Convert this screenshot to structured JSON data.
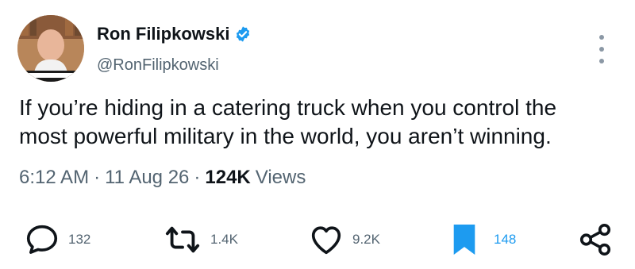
{
  "author": {
    "display_name": "Ron Filipkowski",
    "handle": "@RonFilipkowski",
    "verified": true,
    "avatar_icon": "profile-photo"
  },
  "tweet": {
    "text": "If you’re hiding in a catering truck when you control the\nmost powerful military in the world, you aren’t winning."
  },
  "meta": {
    "time": "6:12 AM",
    "separator": "·",
    "date": "11 Aug 26",
    "views_count": "124K",
    "views_label": "Views"
  },
  "actions": {
    "replies": "132",
    "reposts": "1.4K",
    "likes": "9.2K",
    "bookmarks": "148"
  },
  "colors": {
    "text": "#0f1419",
    "secondary": "#536471",
    "accent": "#1d9bf0"
  }
}
